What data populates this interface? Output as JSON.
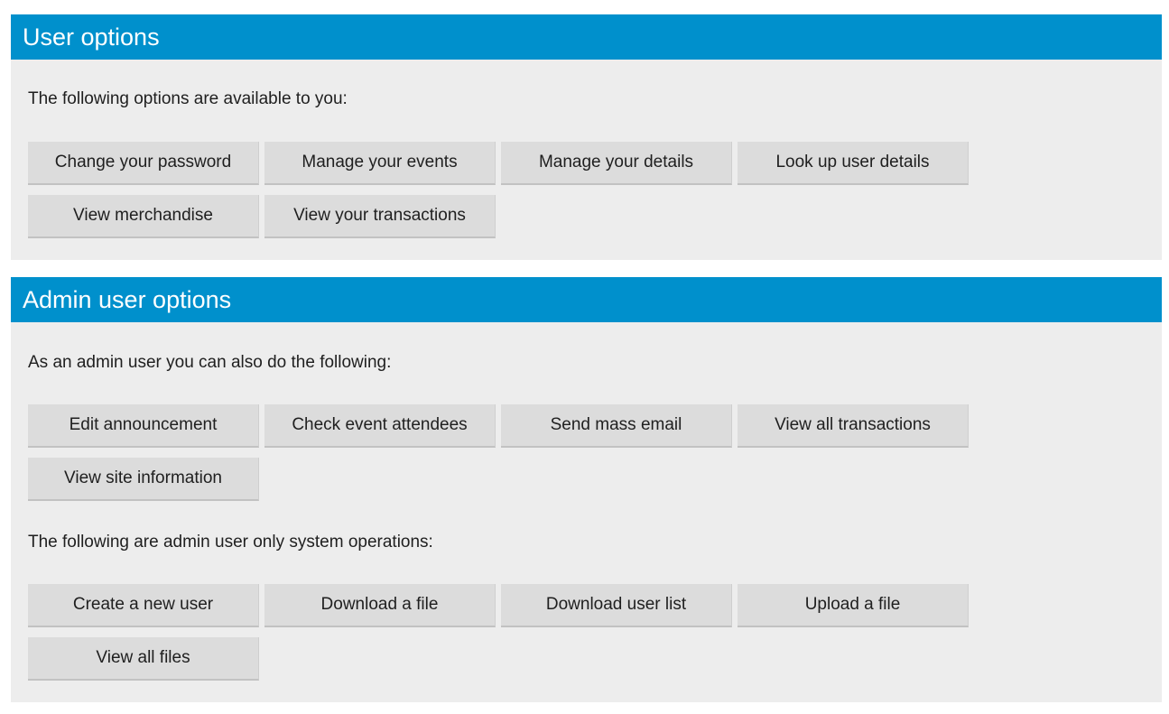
{
  "user_options": {
    "title": "User options",
    "intro": "The following options are available to you:",
    "buttons": [
      "Change your password",
      "Manage your events",
      "Manage your details",
      "Look up user details",
      "View merchandise",
      "View your transactions"
    ]
  },
  "admin_options": {
    "title": "Admin user options",
    "intro": "As an admin user you can also do the following:",
    "buttons": [
      "Edit announcement",
      "Check event attendees",
      "Send mass email",
      "View all transactions",
      "View site information"
    ],
    "system_intro": "The following are admin user only system operations:",
    "system_buttons": [
      "Create a new user",
      "Download a file",
      "Download user list",
      "Upload a file",
      "View all files"
    ]
  },
  "colors": {
    "header_bg": "#0090cc",
    "panel_bg": "#ededed",
    "button_bg": "#dcdcdc"
  }
}
